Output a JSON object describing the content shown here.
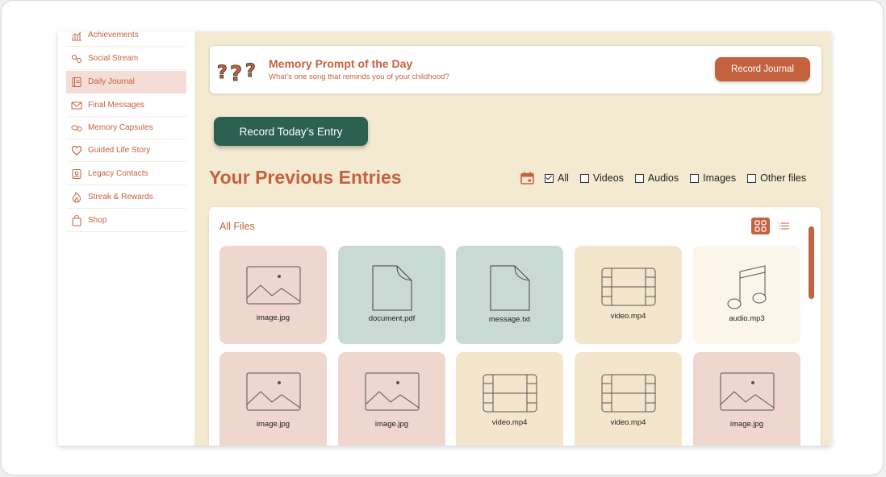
{
  "sidebar": {
    "items": [
      {
        "label": "Achievements",
        "icon": "chart-icon"
      },
      {
        "label": "Social Stream",
        "icon": "social-icon"
      },
      {
        "label": "Daily Journal",
        "icon": "journal-icon",
        "active": true
      },
      {
        "label": "Final Messages",
        "icon": "mail-icon"
      },
      {
        "label": "Memory Capsules",
        "icon": "capsule-icon"
      },
      {
        "label": "Guided Life Story",
        "icon": "heart-icon"
      },
      {
        "label": "Legacy Contacts",
        "icon": "contacts-icon"
      },
      {
        "label": "Streak & Rewards",
        "icon": "flame-icon"
      },
      {
        "label": "Shop",
        "icon": "bag-icon"
      }
    ]
  },
  "prompt": {
    "title": "Memory Prompt of the Day",
    "subtitle": "What’s one song that reminds you of your childhood?",
    "button": "Record Journal"
  },
  "record_button": "Record Today’s Entry",
  "entries": {
    "title": "Your Previous Entries",
    "filters": [
      {
        "label": "All",
        "checked": true
      },
      {
        "label": "Videos",
        "checked": false
      },
      {
        "label": "Audios",
        "checked": false
      },
      {
        "label": "Images",
        "checked": false
      },
      {
        "label": "Other files",
        "checked": false
      }
    ]
  },
  "files": {
    "header": "All Files",
    "view": "grid",
    "items": [
      {
        "name": "image.jpg",
        "type": "image"
      },
      {
        "name": "document.pdf",
        "type": "document"
      },
      {
        "name": "message.txt",
        "type": "document"
      },
      {
        "name": "video.mp4",
        "type": "video"
      },
      {
        "name": "audio.mp3",
        "type": "audio"
      },
      {
        "name": "image.jpg",
        "type": "image"
      },
      {
        "name": "image.jpg",
        "type": "image"
      },
      {
        "name": "video.mp4",
        "type": "video"
      },
      {
        "name": "video.mp4",
        "type": "video"
      },
      {
        "name": "image.jpg",
        "type": "image"
      }
    ]
  },
  "colors": {
    "accent": "#c4623f",
    "primary_button": "#2c6152",
    "background": "#f4ead2"
  }
}
